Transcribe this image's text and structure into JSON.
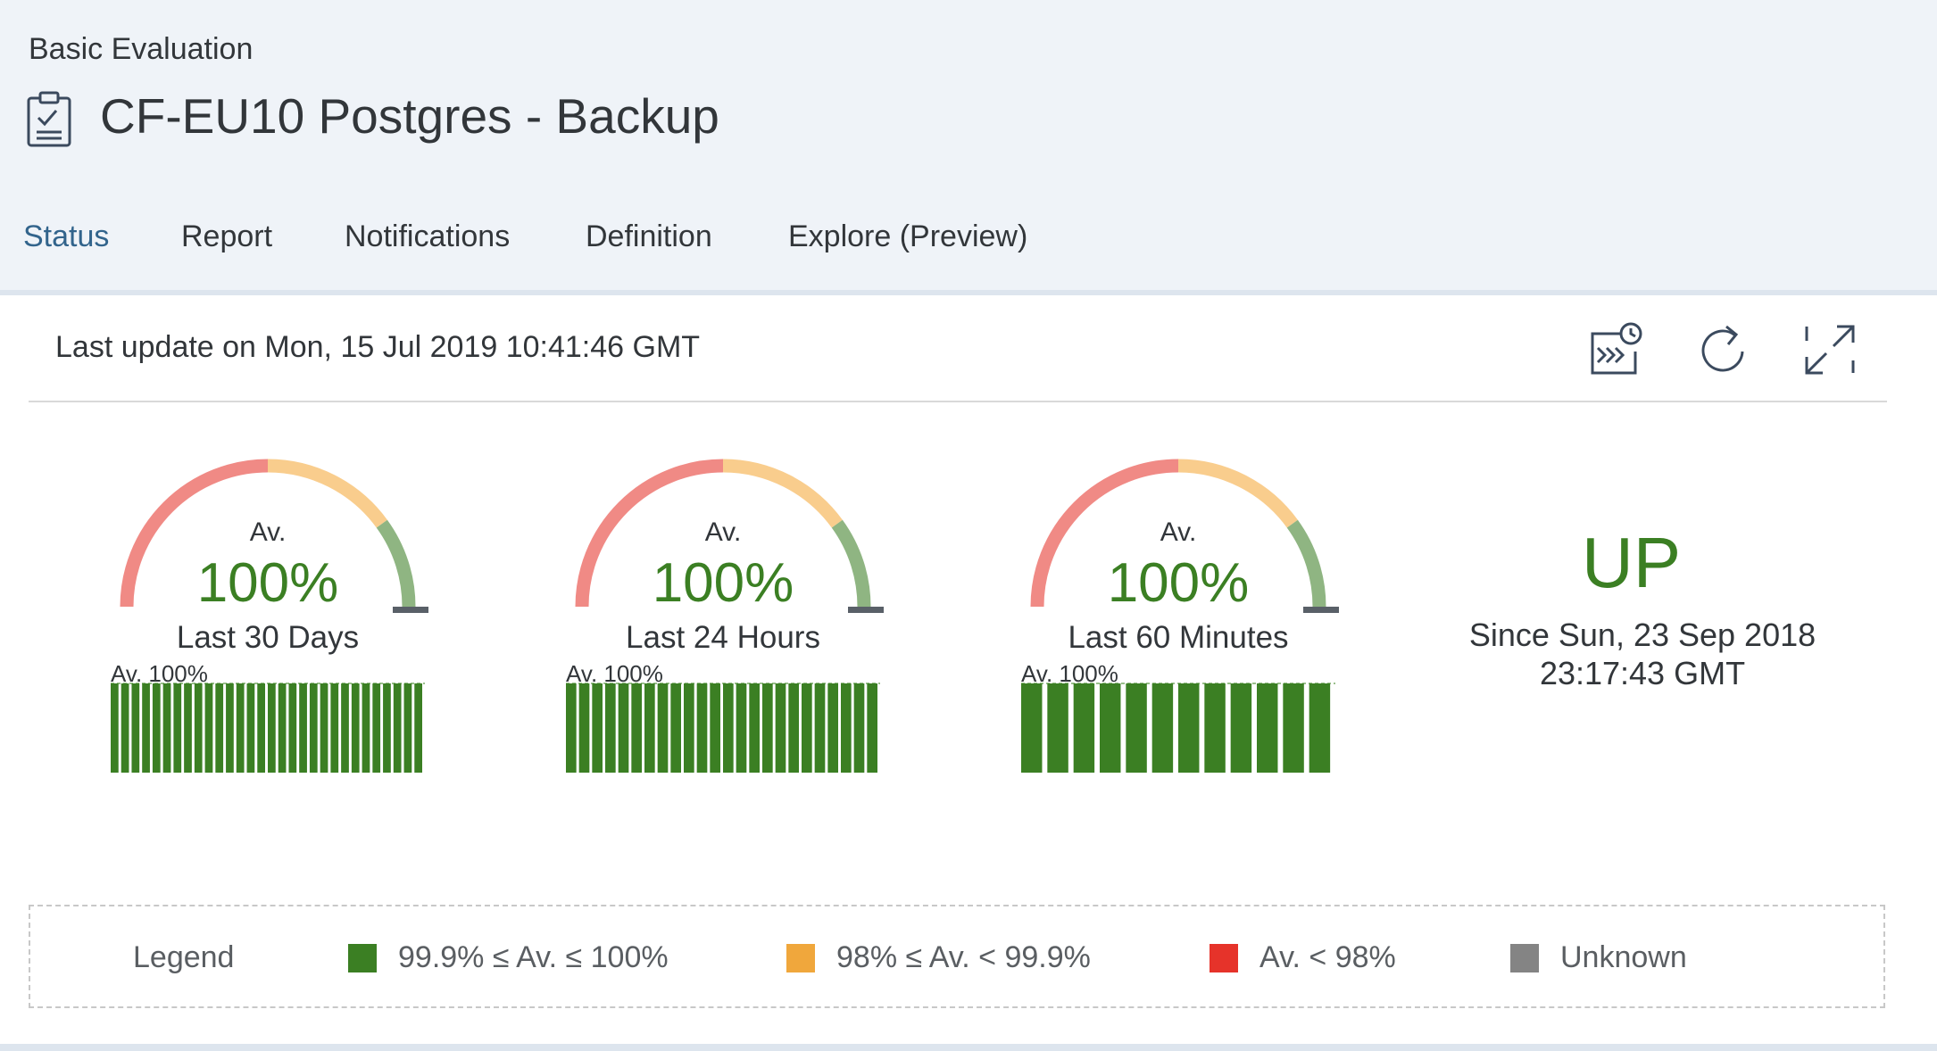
{
  "header": {
    "subtitle": "Basic Evaluation",
    "title": "CF-EU10 Postgres - Backup",
    "title_icon": "clipboard-check-icon"
  },
  "tabs": [
    {
      "label": "Status",
      "active": true
    },
    {
      "label": "Report",
      "active": false
    },
    {
      "label": "Notifications",
      "active": false
    },
    {
      "label": "Definition",
      "active": false
    },
    {
      "label": "Explore (Preview)",
      "active": false
    }
  ],
  "status_bar": {
    "last_update": "Last update on Mon, 15 Jul 2019 10:41:46 GMT",
    "icons": [
      "scheduled-play-icon",
      "refresh-icon",
      "fullscreen-icon"
    ]
  },
  "gauges": [
    {
      "av_label": "Av.",
      "value": "100%",
      "period": "Last 30 Days",
      "bar_label": "Av. 100%",
      "bar_values": [
        100,
        100,
        100,
        100,
        100,
        100,
        100,
        100,
        100,
        100,
        100,
        100,
        100,
        100,
        100,
        100,
        100,
        100,
        100,
        100,
        100,
        100,
        100,
        100,
        100,
        100,
        100,
        100,
        100,
        100
      ]
    },
    {
      "av_label": "Av.",
      "value": "100%",
      "period": "Last 24 Hours",
      "bar_label": "Av. 100%",
      "bar_values": [
        100,
        100,
        100,
        100,
        100,
        100,
        100,
        100,
        100,
        100,
        100,
        100,
        100,
        100,
        100,
        100,
        100,
        100,
        100,
        100,
        100,
        100,
        100,
        100
      ]
    },
    {
      "av_label": "Av.",
      "value": "100%",
      "period": "Last 60 Minutes",
      "bar_label": "Av. 100%",
      "bar_values": [
        100,
        100,
        100,
        100,
        100,
        100,
        100,
        100,
        100,
        100,
        100,
        100
      ]
    }
  ],
  "state": {
    "status": "UP",
    "since_line1": "Since Sun, 23 Sep 2018",
    "since_line2": "23:17:43 GMT"
  },
  "legend": {
    "title": "Legend",
    "items": [
      {
        "label": "99.9% ≤ Av. ≤ 100%",
        "color": "#3b7f23"
      },
      {
        "label": "98% ≤ Av. < 99.9%",
        "color": "#f0a73c"
      },
      {
        "label": "Av. < 98%",
        "color": "#e6332a"
      },
      {
        "label": "Unknown",
        "color": "#848484"
      }
    ]
  },
  "colors": {
    "accent": "#32648c",
    "good": "#3b7f23",
    "gauge_red": "#f08a85",
    "gauge_orange": "#f9cd8d",
    "gauge_green": "#8fb582",
    "needle": "#596068"
  }
}
